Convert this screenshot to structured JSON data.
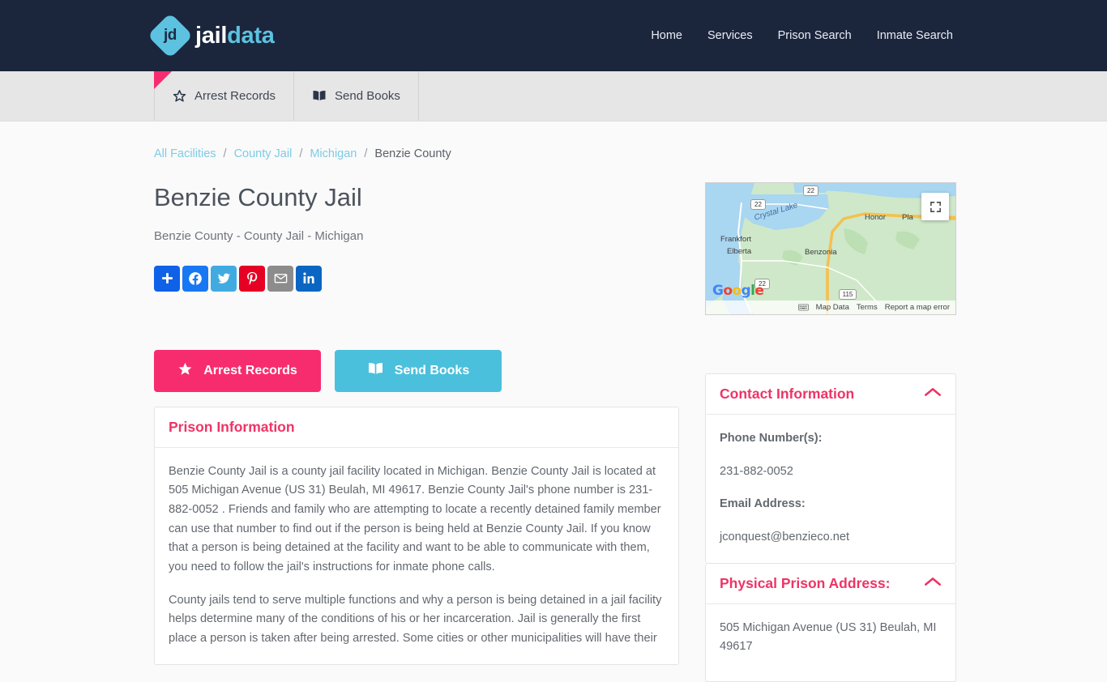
{
  "header": {
    "brand": {
      "mark_text": "jd",
      "word1": "jail",
      "word2": "data"
    },
    "nav": [
      {
        "label": "Home",
        "name": "nav-home"
      },
      {
        "label": "Services",
        "name": "nav-services"
      },
      {
        "label": "Prison Search",
        "name": "nav-prison-search"
      },
      {
        "label": "Inmate Search",
        "name": "nav-inmate-search"
      }
    ]
  },
  "tabbar": {
    "tabs": [
      {
        "label": "Arrest Records",
        "icon": "star-icon"
      },
      {
        "label": "Send Books",
        "icon": "book-icon"
      }
    ]
  },
  "breadcrumb": {
    "items": [
      {
        "label": "All Facilities",
        "link": true
      },
      {
        "label": "County Jail",
        "link": true
      },
      {
        "label": "Michigan",
        "link": true
      },
      {
        "label": "Benzie County",
        "link": false
      }
    ],
    "separator": "/"
  },
  "page": {
    "title": "Benzie County Jail",
    "subtitle": "Benzie County - County Jail - Michigan"
  },
  "share": {
    "buttons": [
      {
        "name": "addthis-share-icon",
        "label": "Share"
      },
      {
        "name": "facebook-share-icon",
        "label": "Facebook"
      },
      {
        "name": "twitter-share-icon",
        "label": "Twitter"
      },
      {
        "name": "pinterest-share-icon",
        "label": "Pinterest"
      },
      {
        "name": "email-share-icon",
        "label": "Email"
      },
      {
        "name": "linkedin-share-icon",
        "label": "LinkedIn"
      }
    ]
  },
  "actions": {
    "arrest_records": "Arrest Records",
    "send_books": "Send Books"
  },
  "prison_information": {
    "heading": "Prison Information",
    "paragraphs": [
      "Benzie County Jail is a county jail facility located in Michigan. Benzie County Jail is located at 505 Michigan Avenue (US 31) Beulah, MI 49617. Benzie County Jail's phone number is 231-882-0052 . Friends and family who are attempting to locate a recently detained family member can use that number to find out if the person is being held at Benzie County Jail. If you know that a person is being detained at the facility and want to be able to communicate with them, you need to follow the jail's instructions for inmate phone calls.",
      "County jails tend to serve multiple functions and why a person is being detained in a jail facility helps determine many of the conditions of his or her incarceration. Jail is generally the first place a person is taken after being arrested. Some cities or other municipalities will have their"
    ]
  },
  "contact": {
    "heading": "Contact Information",
    "phone_label": "Phone Number(s):",
    "phone_value": "231-882-0052",
    "email_label": "Email Address:",
    "email_value": "jconquest@benzieco.net"
  },
  "address": {
    "heading": "Physical Prison Address:",
    "value": "505 Michigan Avenue (US 31) Beulah, MI 49617"
  },
  "map": {
    "labels": {
      "crystal_lake": "Crystal Lake",
      "frankfort": "Frankfort",
      "elberta": "Elberta",
      "benzonia": "Benzonia",
      "honor": "Honor",
      "platte": "Pla",
      "route_22_a": "22",
      "route_22_b": "22",
      "route_22_c": "22",
      "route_115": "115"
    },
    "footer": {
      "map_data": "Map Data",
      "terms": "Terms",
      "report": "Report a map error"
    },
    "google": {
      "g": "G",
      "o1": "o",
      "o2": "o",
      "g2": "g",
      "l": "l",
      "e": "e"
    }
  },
  "colors": {
    "header_bg": "#1b253c",
    "accent_pink": "#f72c6e",
    "accent_cyan": "#4bc0dc",
    "heading_pink": "#ee3465",
    "link_blue": "#7ecbe4"
  }
}
